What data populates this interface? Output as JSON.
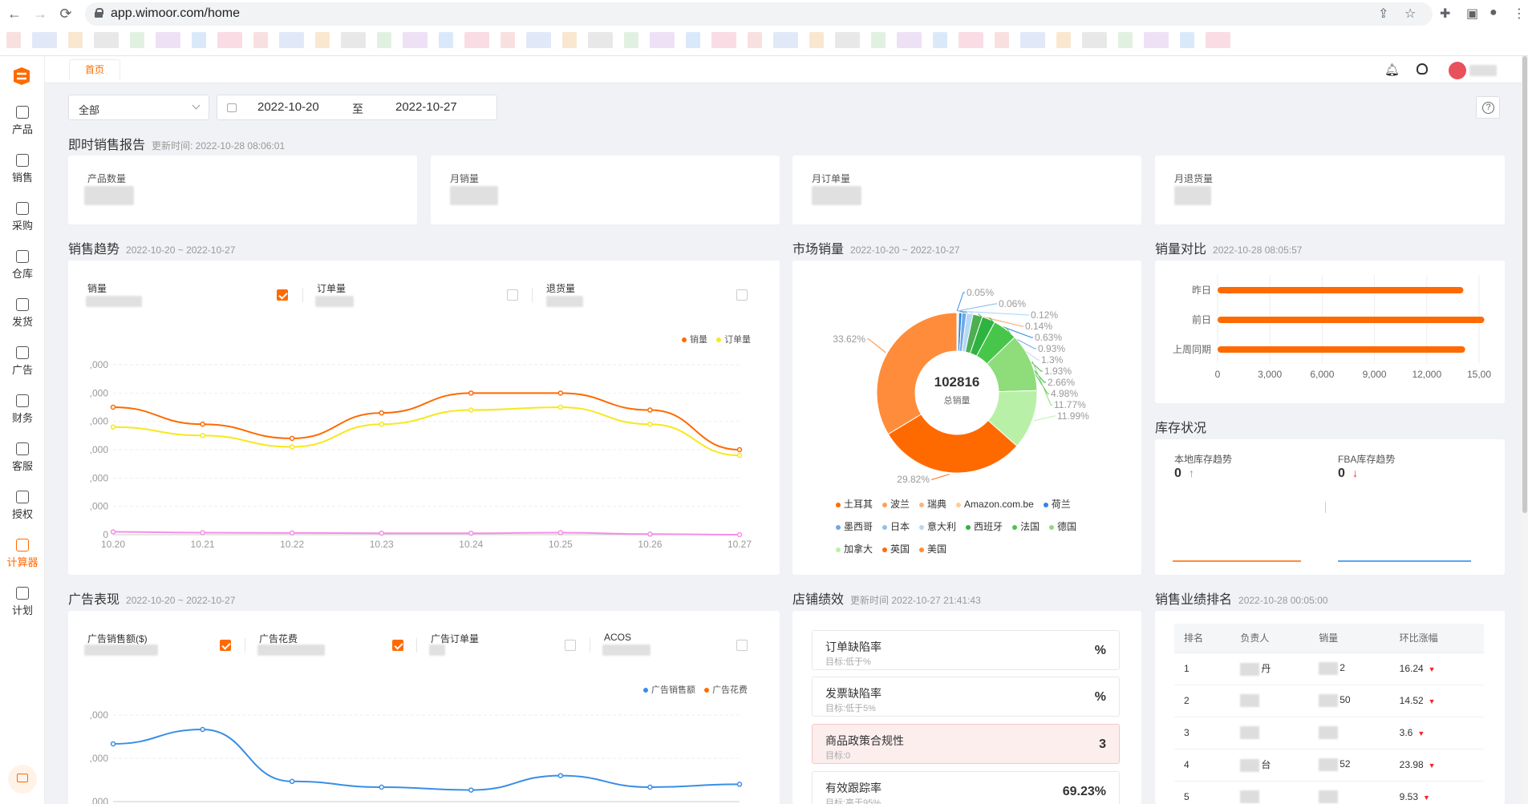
{
  "browser": {
    "url": "app.wimoor.com/home"
  },
  "sidebar": {
    "items": [
      {
        "label": "产品",
        "icon": "product-icon"
      },
      {
        "label": "销售",
        "icon": "sales-icon"
      },
      {
        "label": "采购",
        "icon": "purchase-icon"
      },
      {
        "label": "仓库",
        "icon": "warehouse-icon"
      },
      {
        "label": "发货",
        "icon": "shipping-icon"
      },
      {
        "label": "广告",
        "icon": "ad-icon"
      },
      {
        "label": "财务",
        "icon": "finance-icon"
      },
      {
        "label": "客服",
        "icon": "service-icon"
      },
      {
        "label": "授权",
        "icon": "auth-icon"
      },
      {
        "label": "计算器",
        "icon": "calculator-icon",
        "active": true
      },
      {
        "label": "计划",
        "icon": "plan-icon"
      }
    ]
  },
  "tabs": {
    "home": "首页"
  },
  "filter": {
    "select_value": "全部",
    "date_start": "2022-10-20",
    "date_sep": "至",
    "date_end": "2022-10-27"
  },
  "realtime": {
    "title": "即时销售报告",
    "updated": "更新时间: 2022-10-28 08:06:01",
    "cards": [
      {
        "label": "产品数量"
      },
      {
        "label": "月销量"
      },
      {
        "label": "月订单量"
      },
      {
        "label": "月退货量"
      }
    ]
  },
  "trend": {
    "title": "销售趋势",
    "range": "2022-10-20 ~ 2022-10-27",
    "metrics": [
      {
        "label": "销量",
        "checked": true
      },
      {
        "label": "订单量",
        "checked": false
      },
      {
        "label": "退货量",
        "checked": false
      }
    ],
    "legend": [
      "销量",
      "订单量"
    ],
    "y_ticks": [
      ",000",
      ",000",
      ",000",
      ",000",
      ",000",
      ",000",
      "0"
    ],
    "colors": {
      "sales": "#ff6a00",
      "orders": "#f7e81d",
      "returns": "#f58ee8"
    }
  },
  "market": {
    "title": "市场销量",
    "range": "2022-10-20 ~ 2022-10-27",
    "total": "102816",
    "total_label": "总销量",
    "legend": [
      "土耳其",
      "波兰",
      "瑞典",
      "Amazon.com.be",
      "荷兰",
      "墨西哥",
      "日本",
      "意大利",
      "西班牙",
      "法国",
      "德国",
      "加拿大",
      "英国",
      "美国"
    ]
  },
  "compare": {
    "title": "销量对比",
    "time": "2022-10-28 08:05:57",
    "x_ticks": [
      "0",
      "3,000",
      "6,000",
      "9,000",
      "12,000",
      "15,00"
    ]
  },
  "inventory": {
    "title": "库存状况",
    "local_label": "本地库存趋势",
    "local_value": "0",
    "fba_label": "FBA库存趋势",
    "fba_value": "0"
  },
  "ads": {
    "title": "广告表现",
    "range": "2022-10-20 ~ 2022-10-27",
    "metrics": [
      {
        "label": "广告销售额($)",
        "checked": true
      },
      {
        "label": "广告花费",
        "checked": true
      },
      {
        "label": "广告订单量",
        "checked": false
      },
      {
        "label": "ACOS",
        "checked": false
      }
    ],
    "legend": [
      "广告销售额",
      "广告花费"
    ],
    "y_ticks": [
      ",000",
      ",000",
      ",000"
    ]
  },
  "store": {
    "title": "店铺绩效",
    "updated": "更新时间 2022-10-27 21:41:43",
    "rows": [
      {
        "name": "订单缺陷率",
        "target": "目标:低于%",
        "value": "%",
        "warn": false
      },
      {
        "name": "发票缺陷率",
        "target": "目标:低于5%",
        "value": "%",
        "warn": false
      },
      {
        "name": "商品政策合规性",
        "target": "目标:0",
        "value": "3",
        "warn": true
      },
      {
        "name": "有效跟踪率",
        "target": "目标:高于95%",
        "value": "69.23%",
        "warn": false
      }
    ]
  },
  "ranking": {
    "title": "销售业绩排名",
    "time": "2022-10-28 00:05:00",
    "headers": [
      "排名",
      "负责人",
      "销量",
      "环比涨幅"
    ],
    "rows": [
      {
        "rank": "1",
        "owner": "丹",
        "sales": "2",
        "change": "16.24"
      },
      {
        "rank": "2",
        "owner": "",
        "sales": "50",
        "change": "14.52"
      },
      {
        "rank": "3",
        "owner": "",
        "sales": "",
        "change": "3.6"
      },
      {
        "rank": "4",
        "owner": "台",
        "sales": "52",
        "change": "23.98"
      },
      {
        "rank": "5",
        "owner": "",
        "sales": "",
        "change": "9.53"
      }
    ]
  },
  "chart_data": [
    {
      "type": "line",
      "title": "销售趋势",
      "x": [
        "10.20",
        "10.21",
        "10.22",
        "10.23",
        "10.24",
        "10.25",
        "10.26",
        "10.27"
      ],
      "series": [
        {
          "name": "销量",
          "values": [
            4.5,
            3.9,
            3.4,
            4.3,
            5.0,
            5.0,
            4.4,
            3.0
          ]
        },
        {
          "name": "订单量",
          "values": [
            3.8,
            3.5,
            3.1,
            3.9,
            4.4,
            4.5,
            3.9,
            2.8
          ]
        },
        {
          "name": "",
          "values": [
            0.1,
            0.07,
            0.06,
            0.05,
            0.05,
            0.07,
            0.02,
            0.0
          ]
        }
      ],
      "ylim": [
        0,
        6
      ]
    },
    {
      "type": "pie",
      "title": "市场销量",
      "labels": [
        "0.05%",
        "0.06%",
        "0.12%",
        "0.14%",
        "0.63%",
        "0.93%",
        "1.3%",
        "1.93%",
        "2.66%",
        "4.98%",
        "11.77%",
        "11.99%",
        "29.82%",
        "33.62%"
      ],
      "values": [
        0.05,
        0.06,
        0.12,
        0.14,
        0.63,
        0.93,
        1.3,
        1.93,
        2.66,
        4.98,
        11.77,
        11.99,
        29.82,
        33.62
      ]
    },
    {
      "type": "bar",
      "title": "销量对比",
      "categories": [
        "昨日",
        "前日",
        "上周同期"
      ],
      "values": [
        14100,
        15300,
        14200
      ],
      "xlim": [
        0,
        15000
      ]
    },
    {
      "type": "line",
      "title": "广告表现",
      "x": [
        "10.20",
        "10.21",
        "10.22",
        "10.23",
        "10.24",
        "10.25",
        "10.26",
        "10.27"
      ],
      "series": [
        {
          "name": "广告销售额",
          "values": [
            2.0,
            2.5,
            0.7,
            0.5,
            0.4,
            0.9,
            0.5,
            0.6
          ]
        }
      ],
      "ylim": [
        0,
        3
      ]
    }
  ]
}
